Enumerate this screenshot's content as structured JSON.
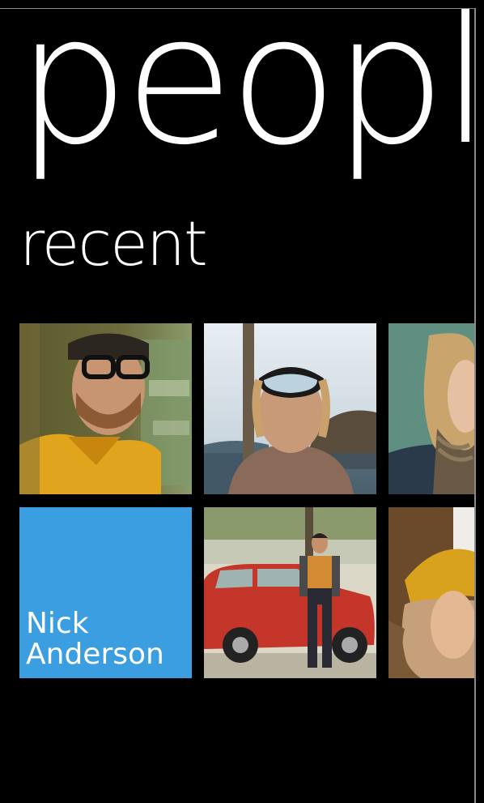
{
  "screen": {
    "title": "people",
    "section": "recent"
  },
  "tiles": [
    {
      "id": "contact-1",
      "kind": "photo",
      "subject": "man with glasses and yellow shirt"
    },
    {
      "id": "contact-2",
      "kind": "photo",
      "subject": "woman with snorkel mask"
    },
    {
      "id": "contact-3",
      "kind": "photo",
      "subject": "woman with blonde hair and scarf"
    },
    {
      "id": "contact-4",
      "kind": "name",
      "first": "Nick",
      "last": "Anderson",
      "accent": "#3a9ee0"
    },
    {
      "id": "contact-5",
      "kind": "photo",
      "subject": "man standing by red car"
    },
    {
      "id": "contact-6",
      "kind": "photo",
      "subject": "person with yellow beanie"
    }
  ],
  "colors": {
    "background": "#000000",
    "accent": "#3a9ee0",
    "text": "#ffffff"
  }
}
